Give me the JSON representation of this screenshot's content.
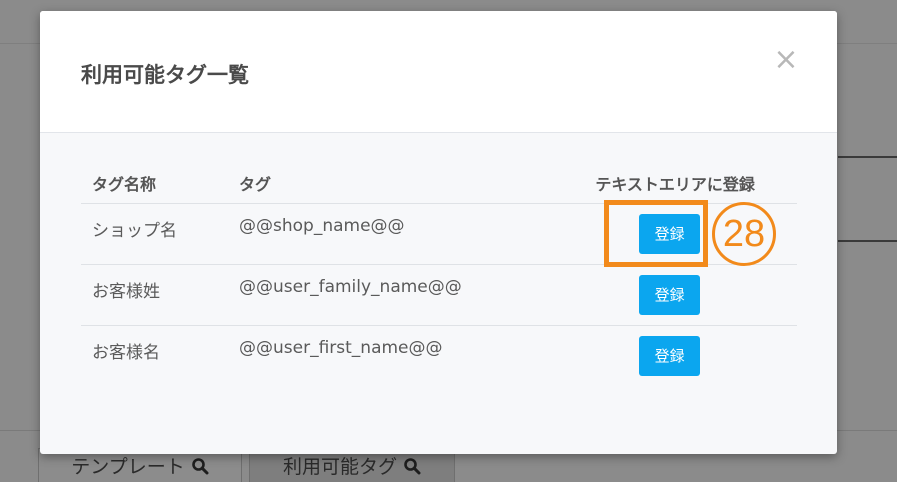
{
  "background": {
    "tabs": [
      {
        "label": "テンプレート",
        "icon": "search-icon"
      },
      {
        "label": "利用可能タグ",
        "icon": "search-icon"
      }
    ]
  },
  "modal": {
    "title": "利用可能タグ一覧",
    "close_label": "×",
    "table": {
      "headers": [
        "タグ名称",
        "タグ",
        "テキストエリアに登録"
      ],
      "rows": [
        {
          "name": "ショップ名",
          "tag": "@@shop_name@@",
          "button": "登録"
        },
        {
          "name": "お客様姓",
          "tag": "@@user_family_name@@",
          "button": "登録"
        },
        {
          "name": "お客様名",
          "tag": "@@user_first_name@@",
          "button": "登録"
        }
      ]
    }
  },
  "annotation": {
    "number": "28",
    "color": "#f28a1b"
  },
  "colors": {
    "button": "#0ba6ef",
    "overlay": "#8b8b8b"
  }
}
